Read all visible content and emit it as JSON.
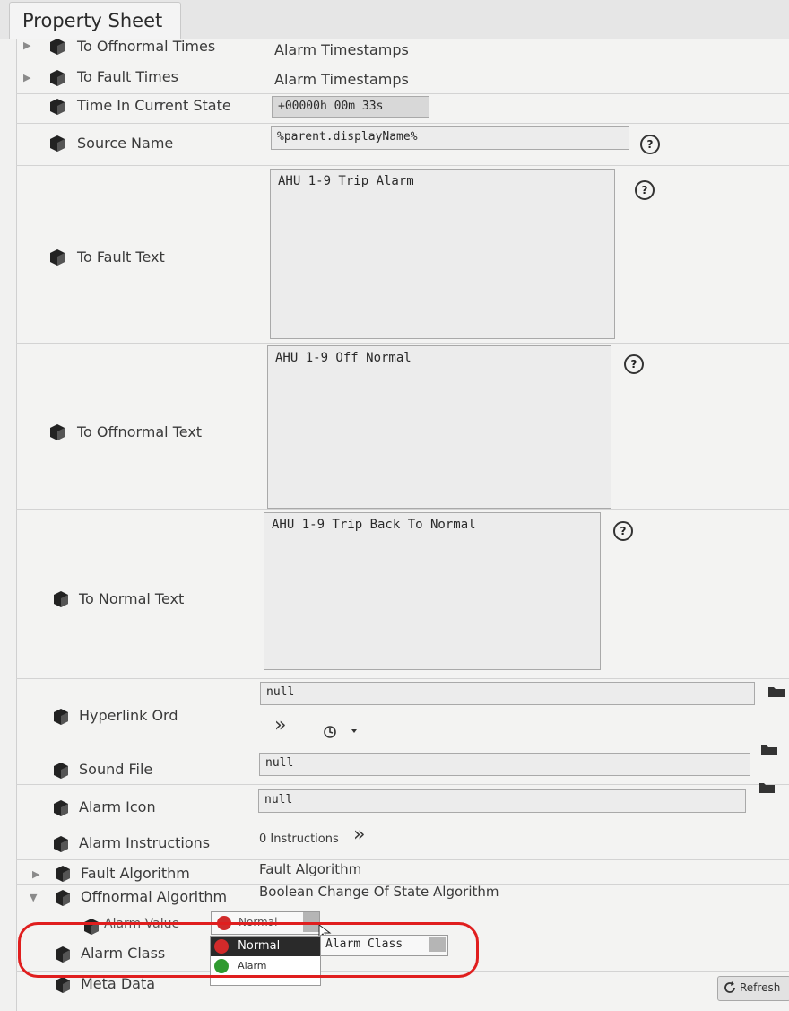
{
  "window": {
    "title": "Property Sheet"
  },
  "rows": {
    "to_offnormal_times": {
      "label": "To Offnormal Times",
      "value": "Alarm Timestamps"
    },
    "to_fault_times": {
      "label": "To Fault Times",
      "value": "Alarm Timestamps"
    },
    "time_in_current_state": {
      "label": "Time In Current State",
      "value": "+00000h 00m 33s"
    },
    "source_name": {
      "label": "Source Name",
      "value": "%parent.displayName%"
    },
    "to_fault_text": {
      "label": "To Fault Text",
      "value": "AHU 1-9 Trip Alarm"
    },
    "to_offnormal_text": {
      "label": "To Offnormal Text",
      "value": "AHU 1-9 Off Normal"
    },
    "to_normal_text": {
      "label": "To Normal Text",
      "value": "AHU 1-9 Trip Back To Normal"
    },
    "hyperlink_ord": {
      "label": "Hyperlink Ord",
      "value": "null"
    },
    "sound_file": {
      "label": "Sound File",
      "value": "null"
    },
    "alarm_icon": {
      "label": "Alarm Icon",
      "value": "null"
    },
    "alarm_instructions": {
      "label": "Alarm Instructions",
      "value": "0 Instructions"
    },
    "fault_algorithm": {
      "label": "Fault Algorithm",
      "value": "Fault Algorithm"
    },
    "offnormal_algorithm": {
      "label": "Offnormal Algorithm",
      "value": "Boolean Change Of State Algorithm"
    },
    "alarm_value": {
      "label": "Alarm Value",
      "value": "Normal"
    },
    "alarm_class": {
      "label": "Alarm Class",
      "value": "Alarm Class"
    },
    "meta_data": {
      "label": "Meta Data"
    }
  },
  "alarm_value_options": [
    {
      "label": "Normal",
      "color": "#d12a2a",
      "selected": true
    },
    {
      "label": "Alarm",
      "color": "#2f9a2f",
      "selected": false
    }
  ],
  "buttons": {
    "refresh": "Refresh"
  },
  "icons": {
    "help": "?",
    "more": "»",
    "expand": "▶",
    "collapse": "▼"
  },
  "colors": {
    "highlight": "#e01e1e",
    "sheet_bg": "#f3f3f2"
  }
}
